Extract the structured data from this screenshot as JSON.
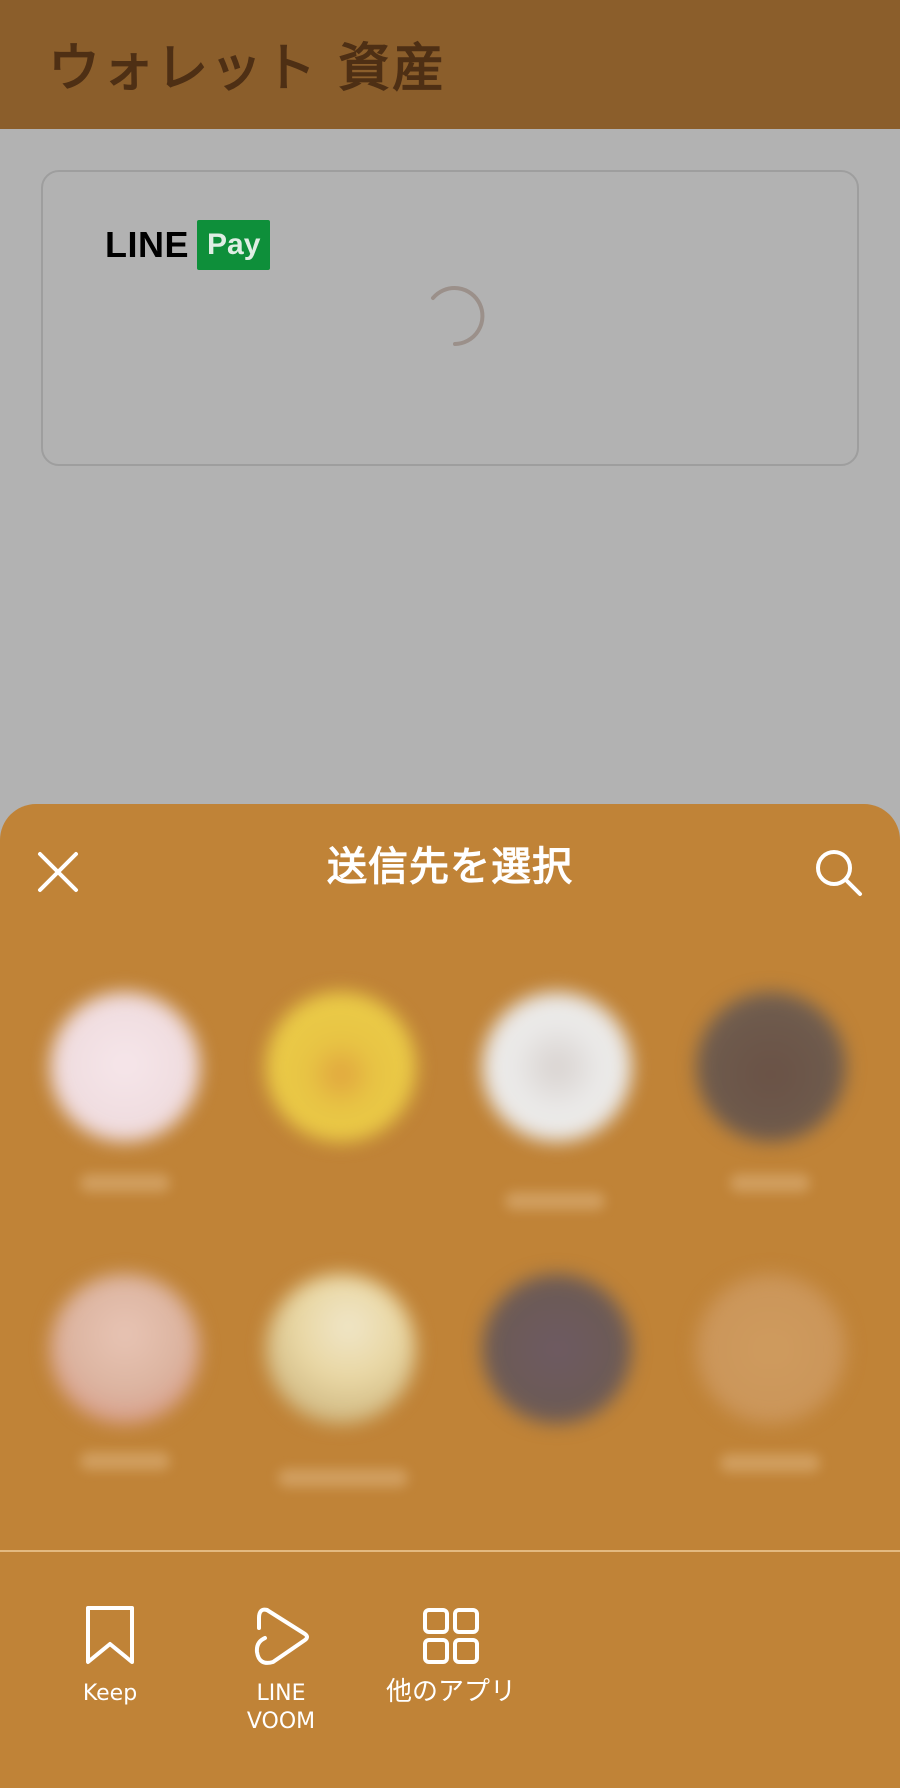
{
  "header": {
    "title": "ウォレット 資産"
  },
  "card": {
    "brand_text": "LINE",
    "brand_badge": "Pay"
  },
  "share_sheet": {
    "title": "送信先を選択",
    "close_icon": "close-icon",
    "search_icon": "search-icon"
  },
  "apps": {
    "keep_label": "Keep",
    "voom_label_1": "LINE",
    "voom_label_2": "VOOM",
    "other_label": "他のアプリ"
  },
  "colors": {
    "header_bg": "#8b5e2b",
    "page_bg": "#b2b2b2",
    "sheet_bg": "#c08337",
    "line_pay_green": "#0e8f3a"
  }
}
